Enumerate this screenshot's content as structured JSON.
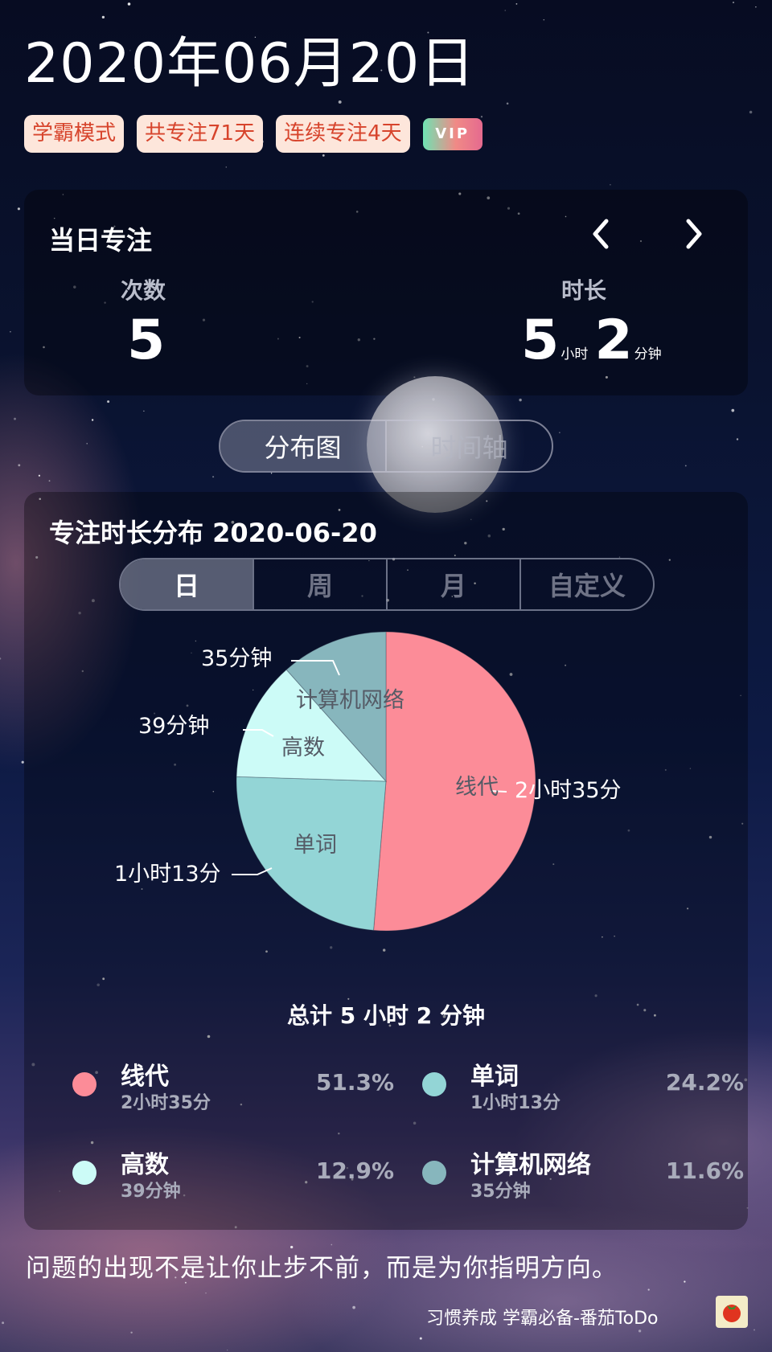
{
  "header": {
    "date_title": "2020年06月20日",
    "tags": [
      "学霸模式",
      "共专注71天",
      "连续专注4天"
    ],
    "vip_label": "VIP"
  },
  "daily": {
    "title": "当日专注",
    "prev_icon": "chevron-left-icon",
    "next_icon": "chevron-right-icon",
    "count_label": "次数",
    "count_value": "5",
    "duration_label": "时长",
    "duration_hours": "5",
    "hours_unit": "小时",
    "duration_minutes": "2",
    "minutes_unit": "分钟"
  },
  "view_toggle": {
    "options": [
      "分布图",
      "时间轴"
    ],
    "selected": "分布图"
  },
  "distribution": {
    "title": "专注时长分布  2020-06-20",
    "ranges": [
      "日",
      "周",
      "月",
      "自定义"
    ],
    "selected_range": "日",
    "total_text": "总计 5 小时 2 分钟"
  },
  "chart_data": {
    "type": "pie",
    "total_minutes": 302,
    "slices": [
      {
        "name": "线代",
        "minutes": 155,
        "label": "2小时35分",
        "percent": 51.3,
        "color": "#fc8c98"
      },
      {
        "name": "单词",
        "minutes": 73,
        "label": "1小时13分",
        "percent": 24.2,
        "color": "#93d5d6"
      },
      {
        "name": "高数",
        "minutes": 39,
        "label": "39分钟",
        "percent": 12.9,
        "color": "#ccfbf7"
      },
      {
        "name": "计算机网络",
        "minutes": 35,
        "label": "35分钟",
        "percent": 11.6,
        "color": "#87b6bd"
      }
    ]
  },
  "legend": [
    {
      "name": "线代",
      "sub": "2小时35分",
      "pct": "51.3%",
      "color": "#fc8c98"
    },
    {
      "name": "单词",
      "sub": "1小时13分",
      "pct": "24.2%",
      "color": "#93d5d6"
    },
    {
      "name": "高数",
      "sub": "39分钟",
      "pct": "12.9%",
      "color": "#ccfbf7"
    },
    {
      "name": "计算机网络",
      "sub": "35分钟",
      "pct": "11.6%",
      "color": "#87b6bd"
    }
  ],
  "quote": "问题的出现不是让你止步不前，而是为你指明方向。",
  "footer": {
    "text": "习惯养成 学霸必备-番茄ToDo",
    "app_icon": "tomato-icon"
  }
}
